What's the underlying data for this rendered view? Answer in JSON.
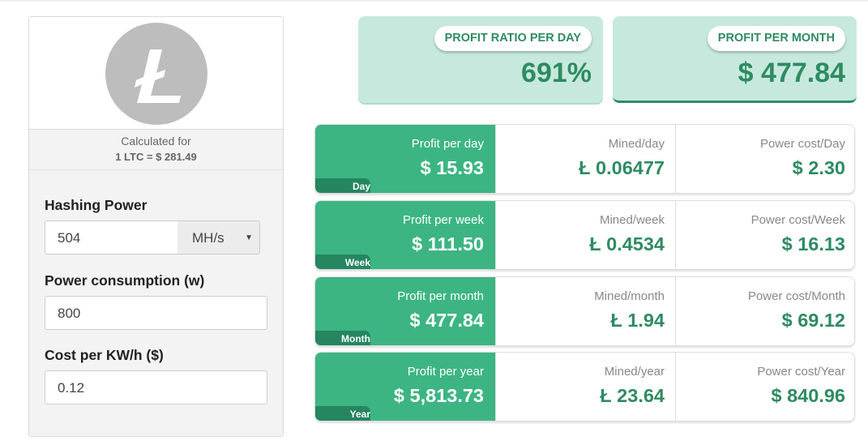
{
  "coin": {
    "icon": "litecoin-icon",
    "calculated_for_label": "Calculated for",
    "rate_text": "1 LTC = $ 281.49"
  },
  "form": {
    "hashing_power": {
      "label": "Hashing Power",
      "value": "504",
      "unit": "MH/s"
    },
    "power_consumption": {
      "label": "Power consumption (w)",
      "value": "800"
    },
    "cost_per_kwh": {
      "label": "Cost per KW/h ($)",
      "value": "0.12"
    }
  },
  "summary": {
    "profit_ratio": {
      "label": "PROFIT RATIO PER DAY",
      "value": "691%"
    },
    "profit_month": {
      "label": "PROFIT PER MONTH",
      "value": "$ 477.84"
    }
  },
  "periods": [
    {
      "tab": "Day",
      "profit_label": "Profit per day",
      "profit_value": "$ 15.93",
      "mined_label": "Mined/day",
      "mined_value": "Ł 0.06477",
      "power_label": "Power cost/Day",
      "power_value": "$ 2.30"
    },
    {
      "tab": "Week",
      "profit_label": "Profit per week",
      "profit_value": "$ 111.50",
      "mined_label": "Mined/week",
      "mined_value": "Ł 0.4534",
      "power_label": "Power cost/Week",
      "power_value": "$ 16.13"
    },
    {
      "tab": "Month",
      "profit_label": "Profit per month",
      "profit_value": "$ 477.84",
      "mined_label": "Mined/month",
      "mined_value": "Ł 1.94",
      "power_label": "Power cost/Month",
      "power_value": "$ 69.12"
    },
    {
      "tab": "Year",
      "profit_label": "Profit per year",
      "profit_value": "$ 5,813.73",
      "mined_label": "Mined/year",
      "mined_value": "Ł 23.64",
      "power_label": "Power cost/Year",
      "power_value": "$ 840.96"
    }
  ],
  "colors": {
    "accent_green": "#3cb583",
    "dark_green": "#2e8b62",
    "summary_bg": "#c7e9dd",
    "coin_gray": "#bdbdbd"
  }
}
